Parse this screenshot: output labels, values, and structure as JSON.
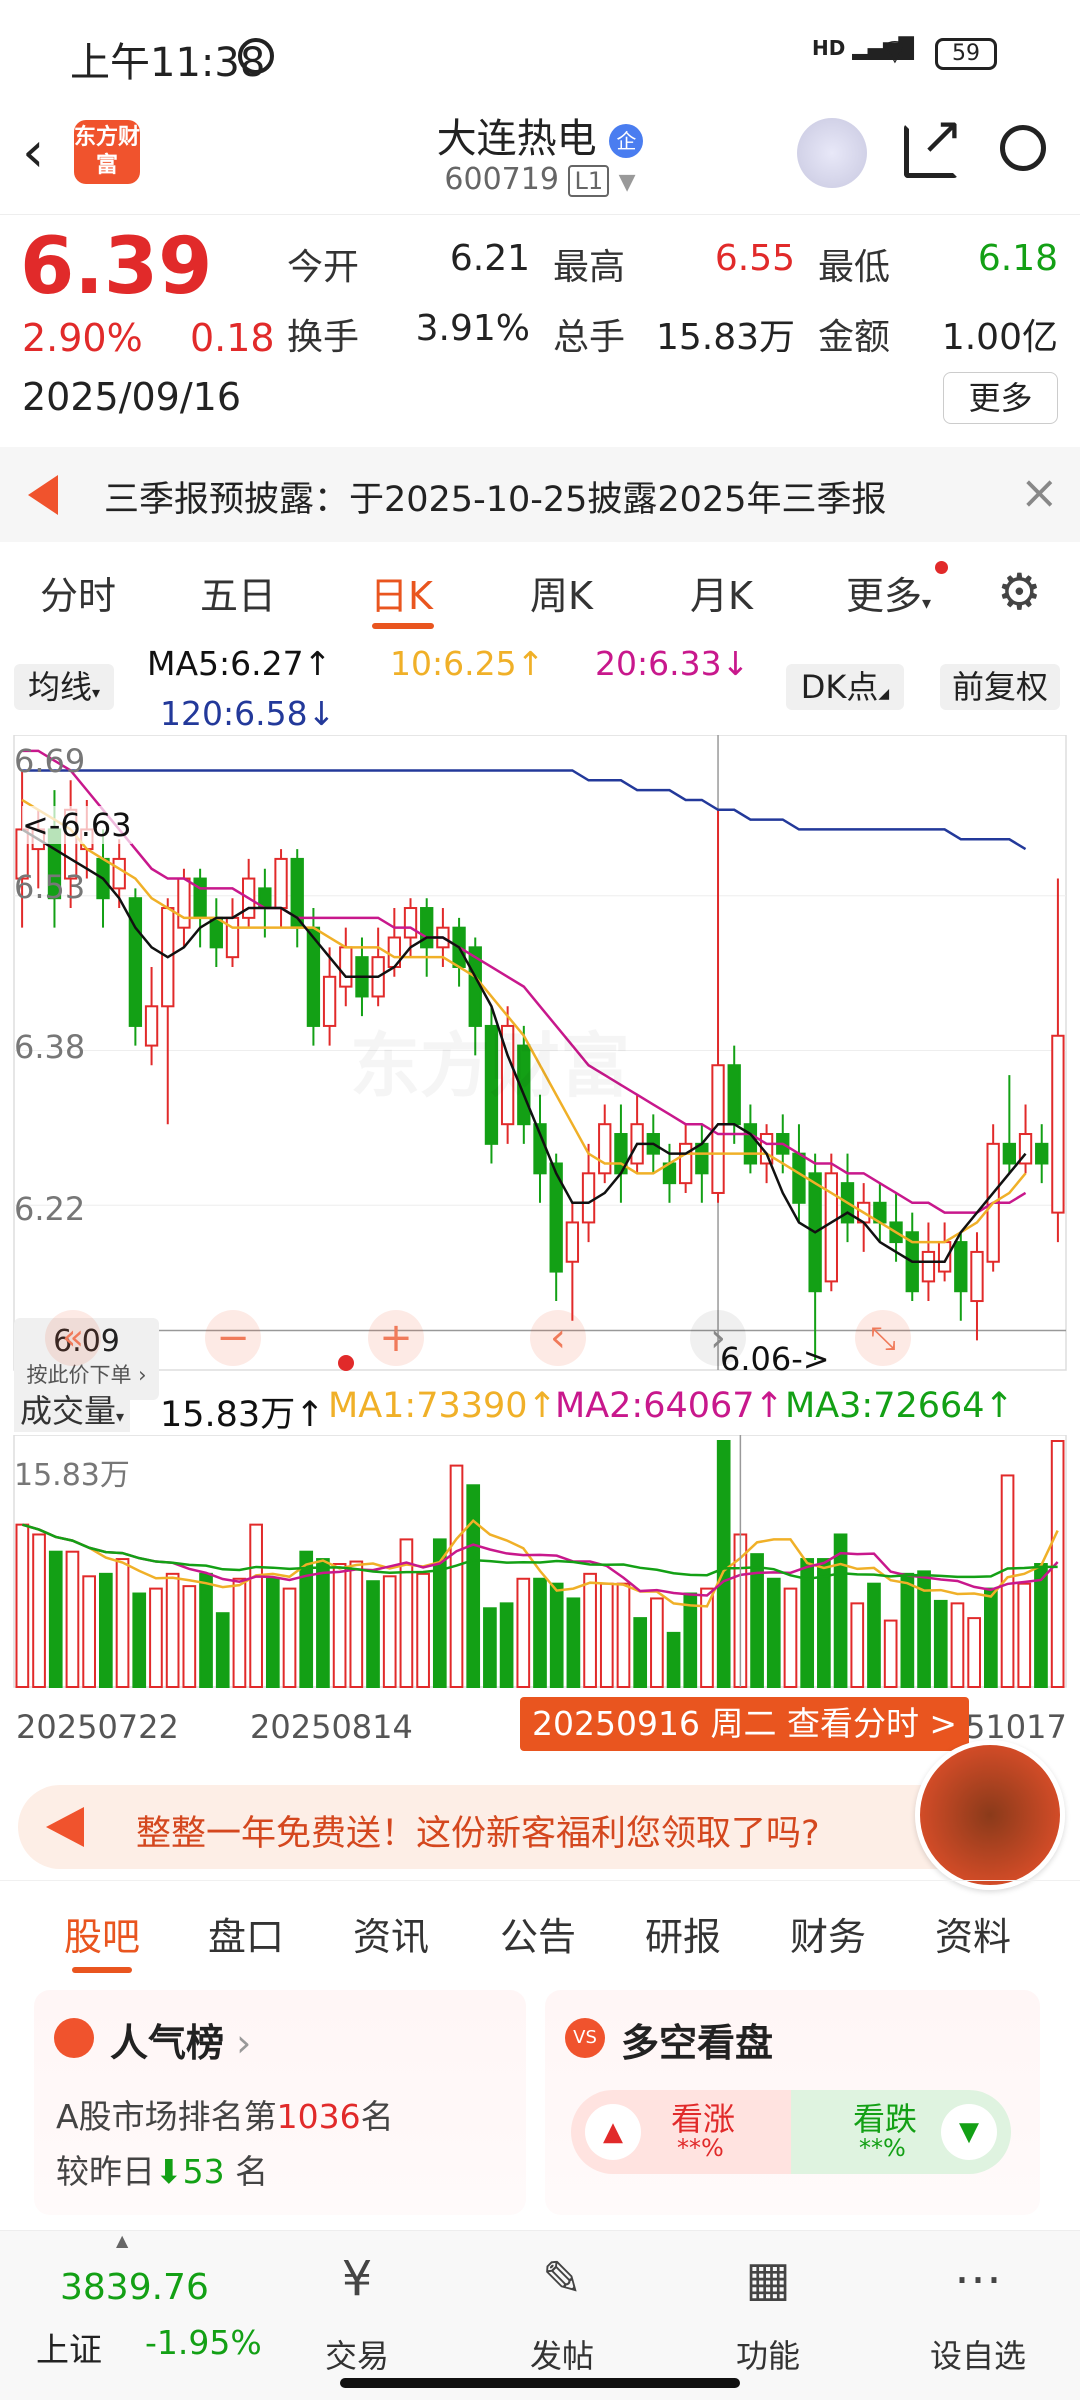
{
  "status": {
    "time": "上午11:38",
    "battery": "59",
    "net": "HD"
  },
  "header": {
    "title": "大连热电",
    "title_badge": "企",
    "code": "600719",
    "market_badge": "L1",
    "logo": "东方财富"
  },
  "quote": {
    "price": "6.39",
    "change_pct": "2.90%",
    "change": "0.18",
    "date": "2025/09/16",
    "open_label": "今开",
    "open": "6.21",
    "high_label": "最高",
    "high": "6.55",
    "low_label": "最低",
    "low": "6.18",
    "turnover_label": "换手",
    "turnover": "3.91%",
    "volume_label": "总手",
    "volume": "15.83万",
    "amount_label": "金额",
    "amount": "1.00亿",
    "more": "更多"
  },
  "notice": {
    "text": "三季报预披露：于2025-10-25披露2025年三季报"
  },
  "chart_tabs": [
    "分时",
    "五日",
    "日K",
    "周K",
    "月K",
    "更多"
  ],
  "chart": {
    "indicator_select": "均线",
    "ma5": "MA5:6.27↑",
    "ma10": "10:6.25↑",
    "ma20": "20:6.33↓",
    "ma120": "120:6.58↓",
    "dk": "DK点",
    "fq": "前复权",
    "y_labels": [
      "6.69",
      "6.53",
      "6.38",
      "6.22"
    ],
    "max_label": "<-6.63",
    "min_label": "6.06->",
    "cross_price": "6.09",
    "cross_hint": "按此价下单",
    "watermark": "东方财富",
    "vol_label": "成交量",
    "vol_value": "15.83万↑",
    "vol_ma1": "MA1:73390↑",
    "vol_ma2": "MA2:64067↑",
    "vol_ma3": "MA3:72664↑",
    "vol_axis": "15.83万",
    "dates": [
      "20250722",
      "20250814",
      "51017"
    ],
    "tooltip": "20250916 周二 查看分时 >"
  },
  "promo": {
    "text": "整整一年免费送！这份新客福利您领取了吗?"
  },
  "content_tabs": [
    "股吧",
    "盘口",
    "资讯",
    "公告",
    "研报",
    "财务",
    "资料"
  ],
  "cards": {
    "rank_title": "人气榜",
    "rank_line1_prefix": "A股市场排名第",
    "rank_num": "1036",
    "rank_suffix": "名",
    "rank_line2_prefix": "较昨日",
    "rank_change": "53",
    "rank_line2_suffix": "名",
    "bull_title": "多空看盘",
    "bull_up": "看涨",
    "bull_up_val": "**%",
    "bull_down": "看跌",
    "bull_down_val": "**%"
  },
  "bottom_nav": {
    "index_value": "3839.76",
    "index_name": "上证",
    "index_change": "-1.95%",
    "trade": "交易",
    "post": "发帖",
    "func": "功能",
    "watch": "设自选"
  },
  "chart_data": {
    "type": "candlestick",
    "ylim": [
      6.06,
      6.69
    ],
    "candles": [
      {
        "o": 6.55,
        "c": 6.6,
        "h": 6.66,
        "l": 6.5
      },
      {
        "o": 6.58,
        "c": 6.6,
        "h": 6.62,
        "l": 6.54
      },
      {
        "o": 6.6,
        "c": 6.53,
        "h": 6.64,
        "l": 6.5
      },
      {
        "o": 6.55,
        "c": 6.62,
        "h": 6.65,
        "l": 6.52
      },
      {
        "o": 6.58,
        "c": 6.6,
        "h": 6.63,
        "l": 6.55
      },
      {
        "o": 6.57,
        "c": 6.53,
        "h": 6.6,
        "l": 6.5
      },
      {
        "o": 6.54,
        "c": 6.57,
        "h": 6.59,
        "l": 6.52
      },
      {
        "o": 6.53,
        "c": 6.4,
        "h": 6.54,
        "l": 6.38
      },
      {
        "o": 6.38,
        "c": 6.42,
        "h": 6.46,
        "l": 6.36
      },
      {
        "o": 6.42,
        "c": 6.52,
        "h": 6.53,
        "l": 6.3
      },
      {
        "o": 6.5,
        "c": 6.55,
        "h": 6.56,
        "l": 6.48
      },
      {
        "o": 6.55,
        "c": 6.51,
        "h": 6.56,
        "l": 6.48
      },
      {
        "o": 6.51,
        "c": 6.48,
        "h": 6.53,
        "l": 6.46
      },
      {
        "o": 6.47,
        "c": 6.51,
        "h": 6.53,
        "l": 6.46
      },
      {
        "o": 6.51,
        "c": 6.55,
        "h": 6.57,
        "l": 6.5
      },
      {
        "o": 6.54,
        "c": 6.52,
        "h": 6.56,
        "l": 6.49
      },
      {
        "o": 6.52,
        "c": 6.57,
        "h": 6.58,
        "l": 6.5
      },
      {
        "o": 6.57,
        "c": 6.5,
        "h": 6.58,
        "l": 6.48
      },
      {
        "o": 6.5,
        "c": 6.4,
        "h": 6.52,
        "l": 6.38
      },
      {
        "o": 6.4,
        "c": 6.45,
        "h": 6.48,
        "l": 6.38
      },
      {
        "o": 6.44,
        "c": 6.48,
        "h": 6.5,
        "l": 6.42
      },
      {
        "o": 6.47,
        "c": 6.43,
        "h": 6.49,
        "l": 6.41
      },
      {
        "o": 6.43,
        "c": 6.47,
        "h": 6.5,
        "l": 6.42
      },
      {
        "o": 6.46,
        "c": 6.49,
        "h": 6.52,
        "l": 6.45
      },
      {
        "o": 6.49,
        "c": 6.52,
        "h": 6.53,
        "l": 6.47
      },
      {
        "o": 6.52,
        "c": 6.48,
        "h": 6.53,
        "l": 6.45
      },
      {
        "o": 6.48,
        "c": 6.5,
        "h": 6.52,
        "l": 6.46
      },
      {
        "o": 6.5,
        "c": 6.46,
        "h": 6.51,
        "l": 6.44
      },
      {
        "o": 6.48,
        "c": 6.4,
        "h": 6.49,
        "l": 6.37
      },
      {
        "o": 6.4,
        "c": 6.28,
        "h": 6.42,
        "l": 6.26
      },
      {
        "o": 6.3,
        "c": 6.4,
        "h": 6.42,
        "l": 6.28
      },
      {
        "o": 6.38,
        "c": 6.3,
        "h": 6.4,
        "l": 6.28
      },
      {
        "o": 6.3,
        "c": 6.25,
        "h": 6.33,
        "l": 6.22
      },
      {
        "o": 6.26,
        "c": 6.15,
        "h": 6.27,
        "l": 6.12
      },
      {
        "o": 6.16,
        "c": 6.2,
        "h": 6.22,
        "l": 6.1
      },
      {
        "o": 6.2,
        "c": 6.25,
        "h": 6.28,
        "l": 6.18
      },
      {
        "o": 6.25,
        "c": 6.3,
        "h": 6.32,
        "l": 6.24
      },
      {
        "o": 6.29,
        "c": 6.25,
        "h": 6.32,
        "l": 6.22
      },
      {
        "o": 6.26,
        "c": 6.3,
        "h": 6.33,
        "l": 6.25
      },
      {
        "o": 6.29,
        "c": 6.27,
        "h": 6.31,
        "l": 6.25
      },
      {
        "o": 6.26,
        "c": 6.24,
        "h": 6.28,
        "l": 6.22
      },
      {
        "o": 6.24,
        "c": 6.28,
        "h": 6.3,
        "l": 6.23
      },
      {
        "o": 6.28,
        "c": 6.25,
        "h": 6.3,
        "l": 6.22
      },
      {
        "o": 6.23,
        "c": 6.36,
        "h": 6.62,
        "l": 6.22
      },
      {
        "o": 6.36,
        "c": 6.3,
        "h": 6.38,
        "l": 6.28
      },
      {
        "o": 6.3,
        "c": 6.26,
        "h": 6.32,
        "l": 6.25
      },
      {
        "o": 6.26,
        "c": 6.29,
        "h": 6.3,
        "l": 6.24
      },
      {
        "o": 6.29,
        "c": 6.27,
        "h": 6.31,
        "l": 6.25
      },
      {
        "o": 6.27,
        "c": 6.22,
        "h": 6.3,
        "l": 6.2
      },
      {
        "o": 6.25,
        "c": 6.13,
        "h": 6.27,
        "l": 6.06
      },
      {
        "o": 6.14,
        "c": 6.25,
        "h": 6.27,
        "l": 6.13
      },
      {
        "o": 6.24,
        "c": 6.2,
        "h": 6.27,
        "l": 6.18
      },
      {
        "o": 6.2,
        "c": 6.22,
        "h": 6.24,
        "l": 6.17
      },
      {
        "o": 6.22,
        "c": 6.2,
        "h": 6.24,
        "l": 6.18
      },
      {
        "o": 6.2,
        "c": 6.18,
        "h": 6.23,
        "l": 6.16
      },
      {
        "o": 6.19,
        "c": 6.13,
        "h": 6.21,
        "l": 6.12
      },
      {
        "o": 6.14,
        "c": 6.17,
        "h": 6.2,
        "l": 6.12
      },
      {
        "o": 6.15,
        "c": 6.18,
        "h": 6.2,
        "l": 6.14
      },
      {
        "o": 6.18,
        "c": 6.13,
        "h": 6.19,
        "l": 6.1
      },
      {
        "o": 6.12,
        "c": 6.17,
        "h": 6.19,
        "l": 6.08
      },
      {
        "o": 6.16,
        "c": 6.28,
        "h": 6.3,
        "l": 6.15
      },
      {
        "o": 6.28,
        "c": 6.26,
        "h": 6.35,
        "l": 6.25
      },
      {
        "o": 6.26,
        "c": 6.29,
        "h": 6.32,
        "l": 6.25
      },
      {
        "o": 6.28,
        "c": 6.26,
        "h": 6.3,
        "l": 6.24
      },
      {
        "o": 6.21,
        "c": 6.39,
        "h": 6.55,
        "l": 6.18
      }
    ],
    "ma5": [
      6.6,
      6.59,
      6.58,
      6.57,
      6.56,
      6.55,
      6.53,
      6.5,
      6.48,
      6.47,
      6.48,
      6.5,
      6.51,
      6.51,
      6.52,
      6.52,
      6.52,
      6.51,
      6.49,
      6.47,
      6.45,
      6.45,
      6.45,
      6.46,
      6.48,
      6.49,
      6.49,
      6.48,
      6.45,
      6.42,
      6.37,
      6.33,
      6.29,
      6.25,
      6.22,
      6.22,
      6.23,
      6.25,
      6.28,
      6.28,
      6.27,
      6.27,
      6.28,
      6.3,
      6.3,
      6.29,
      6.27,
      6.23,
      6.2,
      6.19,
      6.2,
      6.21,
      6.2,
      6.18,
      6.17,
      6.16,
      6.16,
      6.16,
      6.19,
      6.21,
      6.23,
      6.25,
      6.27
    ],
    "ma10": [
      6.63,
      6.62,
      6.61,
      6.6,
      6.58,
      6.57,
      6.56,
      6.55,
      6.53,
      6.52,
      6.51,
      6.51,
      6.51,
      6.5,
      6.5,
      6.5,
      6.5,
      6.5,
      6.5,
      6.49,
      6.48,
      6.48,
      6.48,
      6.47,
      6.47,
      6.47,
      6.47,
      6.46,
      6.45,
      6.43,
      6.41,
      6.39,
      6.36,
      6.33,
      6.3,
      6.27,
      6.26,
      6.26,
      6.25,
      6.25,
      6.26,
      6.27,
      6.27,
      6.27,
      6.27,
      6.27,
      6.27,
      6.26,
      6.25,
      6.24,
      6.23,
      6.22,
      6.21,
      6.2,
      6.19,
      6.18,
      6.18,
      6.18,
      6.19,
      6.2,
      6.22,
      6.23,
      6.25
    ],
    "ma20": [
      6.68,
      6.68,
      6.67,
      6.66,
      6.64,
      6.62,
      6.6,
      6.58,
      6.56,
      6.55,
      6.55,
      6.54,
      6.54,
      6.54,
      6.53,
      6.52,
      6.52,
      6.51,
      6.51,
      6.51,
      6.51,
      6.51,
      6.51,
      6.5,
      6.5,
      6.49,
      6.49,
      6.48,
      6.47,
      6.46,
      6.45,
      6.44,
      6.42,
      6.4,
      6.38,
      6.36,
      6.35,
      6.34,
      6.33,
      6.32,
      6.31,
      6.3,
      6.3,
      6.29,
      6.29,
      6.29,
      6.28,
      6.28,
      6.27,
      6.26,
      6.26,
      6.25,
      6.25,
      6.24,
      6.23,
      6.22,
      6.22,
      6.21,
      6.21,
      6.21,
      6.22,
      6.22,
      6.23
    ],
    "ma120": [
      6.66,
      6.66,
      6.66,
      6.66,
      6.66,
      6.66,
      6.66,
      6.66,
      6.66,
      6.66,
      6.66,
      6.66,
      6.66,
      6.66,
      6.66,
      6.66,
      6.66,
      6.66,
      6.66,
      6.66,
      6.66,
      6.66,
      6.66,
      6.66,
      6.66,
      6.66,
      6.66,
      6.66,
      6.66,
      6.66,
      6.66,
      6.66,
      6.66,
      6.66,
      6.66,
      6.65,
      6.65,
      6.65,
      6.64,
      6.64,
      6.64,
      6.63,
      6.63,
      6.62,
      6.62,
      6.61,
      6.61,
      6.61,
      6.6,
      6.6,
      6.6,
      6.6,
      6.6,
      6.6,
      6.6,
      6.6,
      6.6,
      6.6,
      6.59,
      6.59,
      6.59,
      6.59,
      6.58
    ],
    "volume": [
      0.66,
      0.62,
      0.55,
      0.55,
      0.45,
      0.46,
      0.52,
      0.38,
      0.4,
      0.46,
      0.41,
      0.46,
      0.3,
      0.44,
      0.66,
      0.44,
      0.4,
      0.55,
      0.52,
      0.5,
      0.51,
      0.43,
      0.45,
      0.6,
      0.46,
      0.6,
      0.9,
      0.82,
      0.32,
      0.34,
      0.44,
      0.44,
      0.42,
      0.36,
      0.46,
      0.42,
      0.42,
      0.28,
      0.36,
      0.22,
      0.38,
      0.4,
      1.0,
      0.62,
      0.54,
      0.44,
      0.4,
      0.52,
      0.52,
      0.62,
      0.34,
      0.42,
      0.27,
      0.46,
      0.47,
      0.35,
      0.34,
      0.28,
      0.4,
      0.86,
      0.42,
      0.5,
      1.0
    ]
  }
}
